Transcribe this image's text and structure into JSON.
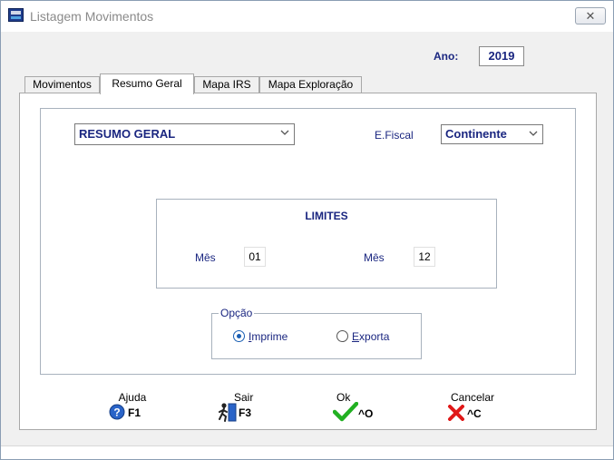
{
  "window": {
    "title": "Listagem Movimentos",
    "close_glyph": "✕"
  },
  "header": {
    "ano_label": "Ano:",
    "ano_value": "2019"
  },
  "tabs": [
    {
      "label": "Movimentos",
      "active": false
    },
    {
      "label": "Resumo Geral",
      "active": true
    },
    {
      "label": "Mapa IRS",
      "active": false
    },
    {
      "label": "Mapa Exploração",
      "active": false
    }
  ],
  "resumo": {
    "report_select": {
      "value": "RESUMO GERAL"
    },
    "efiscal": {
      "label": "E.Fiscal",
      "value": "Continente"
    }
  },
  "limites": {
    "title": "LIMITES",
    "mes_from": {
      "label": "Mês",
      "value": "01"
    },
    "mes_to": {
      "label": "Mês",
      "value": "12"
    }
  },
  "opcao": {
    "legend": "Opção",
    "imprime": {
      "label": "Imprime",
      "underline": "I",
      "rest": "mprime",
      "selected": true
    },
    "exporta": {
      "label": "Exporta",
      "underline": "E",
      "rest": "xporta",
      "selected": false
    }
  },
  "buttons": {
    "ajuda": {
      "caption": "Ajuda",
      "key": "F1",
      "icon": "help-icon"
    },
    "sair": {
      "caption": "Sair",
      "key": "F3",
      "icon": "exit-door-icon"
    },
    "ok": {
      "caption": "Ok",
      "key": "^O",
      "icon": "checkmark-icon"
    },
    "cancelar": {
      "caption": "Cancelar",
      "key": "^C",
      "icon": "red-x-icon"
    }
  },
  "colors": {
    "label_navy": "#1a2680",
    "radio_blue": "#1a5fb4",
    "ok_green": "#22b022",
    "cancel_red": "#e01818",
    "help_blue": "#2a64c8"
  }
}
